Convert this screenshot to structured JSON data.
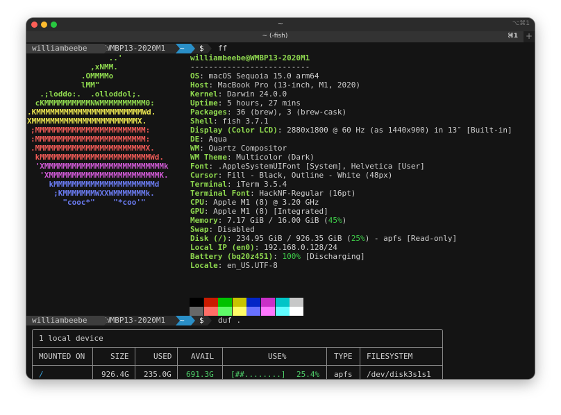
{
  "window": {
    "title": "~",
    "shortcut": "⌥⌘1"
  },
  "tab": {
    "title": "~ (-fish)",
    "shortcut": "⌘1",
    "add": "+"
  },
  "prompt": {
    "user": "williambeebe",
    "host": "WMBP13-2020M1",
    "dir": "~",
    "symbol": "$"
  },
  "commands": {
    "first": "ff",
    "second": "duf ."
  },
  "logo": [
    {
      "text": "                 ..'",
      "color": "#8fd94f"
    },
    {
      "text": "             ,xNMM.",
      "color": "#8fd94f"
    },
    {
      "text": "           .OMMMMo",
      "color": "#8fd94f"
    },
    {
      "text": "           lMM\"",
      "color": "#8fd94f"
    },
    {
      "text": "  .;loddo:.  .olloddol;.",
      "color": "#8fd94f"
    },
    {
      "text": " cKMMMMMMMMMMNWMMMMMMMMMM0:",
      "color": "#8fd94f"
    },
    {
      "text": ".KMMMMMMMMMMMMMMMMMMMMMMMWd.",
      "color": "#e8e34f"
    },
    {
      "text": "XMMMMMMMMMMMMMMMMMMMMMMMX.",
      "color": "#e8e34f"
    },
    {
      "text": ";MMMMMMMMMMMMMMMMMMMMMMMM:",
      "color": "#ef5a56"
    },
    {
      "text": ":MMMMMMMMMMMMMMMMMMMMMMMM:",
      "color": "#ef5a56"
    },
    {
      "text": ".MMMMMMMMMMMMMMMMMMMMMMMMX.",
      "color": "#ef5a56"
    },
    {
      "text": " kMMMMMMMMMMMMMMMMMMMMMMMMWd.",
      "color": "#ef5a56"
    },
    {
      "text": " 'XMMMMMMMMMMMMMMMMMMMMMMMMMMk",
      "color": "#d05ad6"
    },
    {
      "text": "  'XMMMMMMMMMMMMMMMMMMMMMMMMK.",
      "color": "#d05ad6"
    },
    {
      "text": "    kMMMMMMMMMMMMMMMMMMMMMMd",
      "color": "#6a7bf0"
    },
    {
      "text": "     ;KMMMMMMMWXXWMMMMMMMk.",
      "color": "#6a7bf0"
    },
    {
      "text": "       \"cooc*\"    \"*coo'\"",
      "color": "#6a7bf0"
    }
  ],
  "info": {
    "title": "williambeebe@WMBP13-2020M1",
    "separator": "--------------------------",
    "rows": [
      {
        "label": "OS",
        "value": "macOS Sequoia 15.0 arm64"
      },
      {
        "label": "Host",
        "value": "MacBook Pro (13-inch, M1, 2020)"
      },
      {
        "label": "Kernel",
        "value": "Darwin 24.0.0"
      },
      {
        "label": "Uptime",
        "value": "5 hours, 27 mins"
      },
      {
        "label": "Packages",
        "value": "36 (brew), 3 (brew-cask)"
      },
      {
        "label": "Shell",
        "value": "fish 3.7.1"
      },
      {
        "label": "Display (Color LCD)",
        "value": "2880x1800 @ 60 Hz (as 1440x900) in 13″ [Built-in]"
      },
      {
        "label": "DE",
        "value": "Aqua"
      },
      {
        "label": "WM",
        "value": "Quartz Compositor"
      },
      {
        "label": "WM Theme",
        "value": "Multicolor (Dark)"
      },
      {
        "label": "Font",
        "value": ".AppleSystemUIFont [System], Helvetica [User]"
      },
      {
        "label": "Cursor",
        "value": "Fill - Black, Outline - White (48px)"
      },
      {
        "label": "Terminal",
        "value": "iTerm 3.5.4"
      },
      {
        "label": "Terminal Font",
        "value": "HackNF-Regular (16pt)"
      },
      {
        "label": "CPU",
        "value": "Apple M1 (8) @ 3.20 GHz"
      },
      {
        "label": "GPU",
        "value": "Apple M1 (8) [Integrated]"
      },
      {
        "label": "Memory",
        "value": "7.17 GiB / 16.00 GiB (",
        "pct": "45%",
        "after": ")"
      },
      {
        "label": "Swap",
        "value": "Disabled"
      },
      {
        "label": "Disk (/)",
        "value": "234.95 GiB / 926.35 GiB (",
        "pct": "25%",
        "after": ") - apfs [Read-only]"
      },
      {
        "label": "Local IP (en0)",
        "value": "192.168.0.128/24"
      },
      {
        "label": "Battery (bq20z451)",
        "value": "",
        "pct": "100%",
        "after": " [Discharging]"
      },
      {
        "label": "Locale",
        "value": "en_US.UTF-8"
      }
    ]
  },
  "palette": {
    "top": [
      "#000000",
      "#c91b00",
      "#00c200",
      "#c7c400",
      "#0225c7",
      "#c930c7",
      "#00c5c7",
      "#c7c7c7"
    ],
    "bottom": [
      "#686868",
      "#ff6e67",
      "#5ffa68",
      "#fffc67",
      "#6871ff",
      "#ff77ff",
      "#60fdff",
      "#ffffff"
    ]
  },
  "duf": {
    "title": "1 local device",
    "headers": [
      "MOUNTED ON",
      "SIZE",
      "USED",
      "AVAIL",
      "USE%",
      "TYPE",
      "FILESYSTEM"
    ],
    "row": {
      "mounted": "/",
      "size": "926.4G",
      "used": "235.0G",
      "avail": "691.3G",
      "bar": "[##........]",
      "pct": "25.4%",
      "type": "apfs",
      "fs": "/dev/disk3s1s1"
    }
  }
}
